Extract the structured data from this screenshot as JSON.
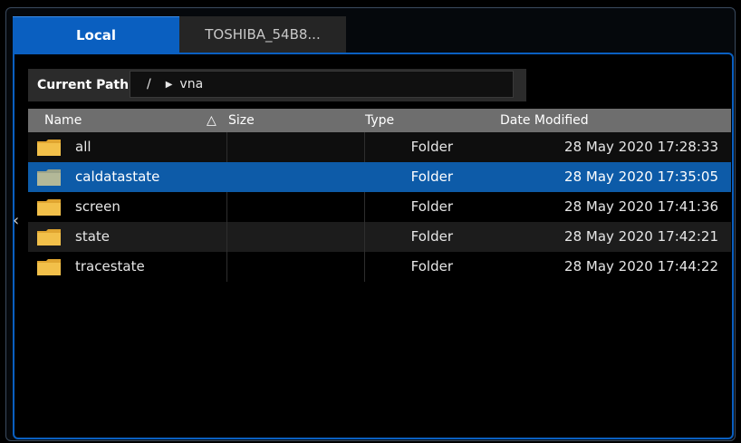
{
  "tabs": [
    {
      "label": "Local",
      "active": true
    },
    {
      "label": "TOSHIBA_54B8...",
      "active": false
    }
  ],
  "path": {
    "label": "Current Path :",
    "root": "/",
    "folder": "vna"
  },
  "columns": {
    "name": "Name",
    "size": "Size",
    "type": "Type",
    "date": "Date Modified"
  },
  "files": [
    {
      "name": "all",
      "type": "Folder",
      "date": "28 May 2020 17:28:33"
    },
    {
      "name": "caldatastate",
      "type": "Folder",
      "date": "28 May 2020 17:35:05",
      "selected": true
    },
    {
      "name": "screen",
      "type": "Folder",
      "date": "28 May 2020 17:41:36"
    },
    {
      "name": "state",
      "type": "Folder",
      "date": "28 May 2020 17:42:21"
    },
    {
      "name": "tracestate",
      "type": "Folder",
      "date": "28 May 2020 17:44:22"
    }
  ],
  "colors": {
    "accent": "#0a5fc0",
    "selection": "#0d5ba8",
    "header": "#6e6e6e",
    "folder": "#f2c04a"
  },
  "icons": {
    "sort": "ascending-triangle-icon",
    "nav": "chevron-left-icon",
    "folder": "folder-icon"
  }
}
